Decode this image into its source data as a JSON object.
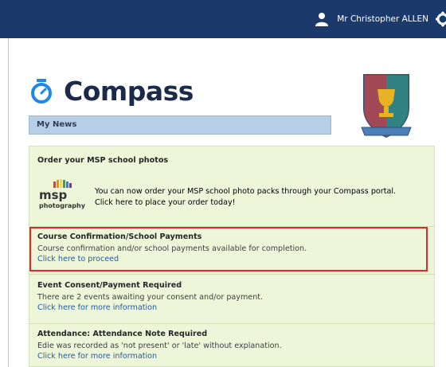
{
  "header": {
    "user_name": "Mr Christopher ALLEN"
  },
  "brand": {
    "app_name": "Compass"
  },
  "news": {
    "heading": "My News",
    "items": [
      {
        "title": "Order your MSP school photos",
        "text": "You can now order your MSP school photo packs through your Compass portal.",
        "link": "Click here to place your order today!",
        "logo_text": "msp",
        "logo_subtext": "photography"
      },
      {
        "title": "Course Confirmation/School Payments",
        "text": "Course confirmation and/or school payments available for completion.",
        "link": "Click here to proceed"
      },
      {
        "title": "Event Consent/Payment Required",
        "text": "There are 2 events awaiting your consent and/or payment.",
        "link": "Click here for more information"
      },
      {
        "title": "Attendance: Attendance Note Required",
        "text": "Edie was recorded as 'not present' or 'late' without explanation.",
        "link": "Click here for more information"
      }
    ]
  },
  "colors": {
    "topbar": "#1b3a6b",
    "highlight": "#e3262b",
    "panel": "#eef6da",
    "link": "#1f5aa6"
  },
  "icons": [
    "user-icon",
    "gear-icon",
    "compass-logo-icon",
    "school-crest-icon",
    "msp-logo-icon"
  ]
}
